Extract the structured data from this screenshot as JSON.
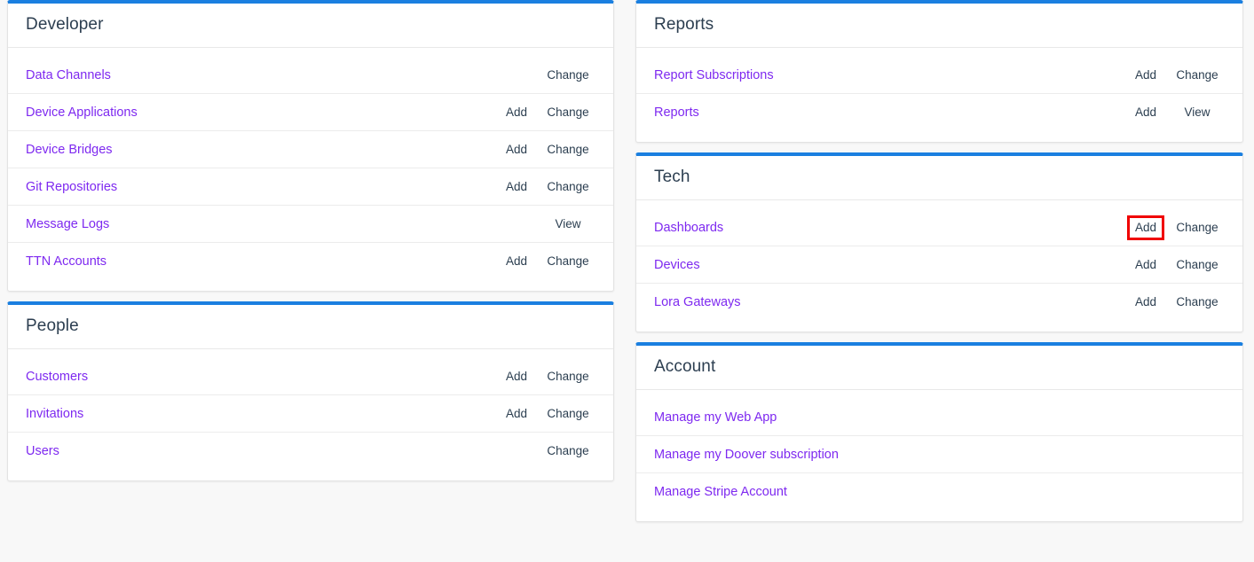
{
  "background_color": "#f8f8f8",
  "accent_color": "#1a7fe0",
  "link_color": "#7e29f0",
  "action_color": "#2b3e50",
  "highlight_color": "#f00000",
  "panels": {
    "developer": {
      "title": "Developer",
      "rows": [
        {
          "label": "Data Channels",
          "add": "",
          "change": "Change"
        },
        {
          "label": "Device Applications",
          "add": "Add",
          "change": "Change"
        },
        {
          "label": "Device Bridges",
          "add": "Add",
          "change": "Change"
        },
        {
          "label": "Git Repositories",
          "add": "Add",
          "change": "Change"
        },
        {
          "label": "Message Logs",
          "add": "",
          "change": "View"
        },
        {
          "label": "TTN Accounts",
          "add": "Add",
          "change": "Change"
        }
      ]
    },
    "people": {
      "title": "People",
      "rows": [
        {
          "label": "Customers",
          "add": "Add",
          "change": "Change"
        },
        {
          "label": "Invitations",
          "add": "Add",
          "change": "Change"
        },
        {
          "label": "Users",
          "add": "",
          "change": "Change"
        }
      ]
    },
    "reports": {
      "title": "Reports",
      "rows": [
        {
          "label": "Report Subscriptions",
          "add": "Add",
          "change": "Change"
        },
        {
          "label": "Reports",
          "add": "Add",
          "change": "View"
        }
      ]
    },
    "tech": {
      "title": "Tech",
      "rows": [
        {
          "label": "Dashboards",
          "add": "Add",
          "change": "Change"
        },
        {
          "label": "Devices",
          "add": "Add",
          "change": "Change"
        },
        {
          "label": "Lora Gateways",
          "add": "Add",
          "change": "Change"
        }
      ]
    },
    "account": {
      "title": "Account",
      "rows": [
        {
          "label": "Manage my Web App"
        },
        {
          "label": "Manage my Doover subscription"
        },
        {
          "label": "Manage Stripe Account"
        }
      ]
    }
  }
}
